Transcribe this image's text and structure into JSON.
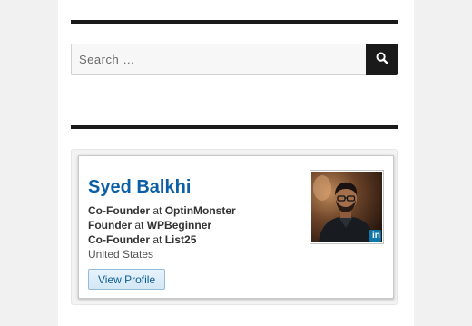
{
  "search": {
    "placeholder": "Search …",
    "button_icon": "search-icon"
  },
  "profile_badge": {
    "name": "Syed Balkhi",
    "positions": [
      {
        "title": "Co-Founder",
        "connector": "at",
        "company": "OptinMonster"
      },
      {
        "title": "Founder",
        "connector": "at",
        "company": "WPBeginner"
      },
      {
        "title": "Co-Founder",
        "connector": "at",
        "company": "List25"
      }
    ],
    "location": "United States",
    "view_profile_label": "View Profile",
    "linkedin_mark": "in",
    "photo_icon": "profile-photo",
    "colors": {
      "name": "#0b5fa5",
      "linkedin": "#0e76a8",
      "rule": "#1a1a1a"
    }
  }
}
